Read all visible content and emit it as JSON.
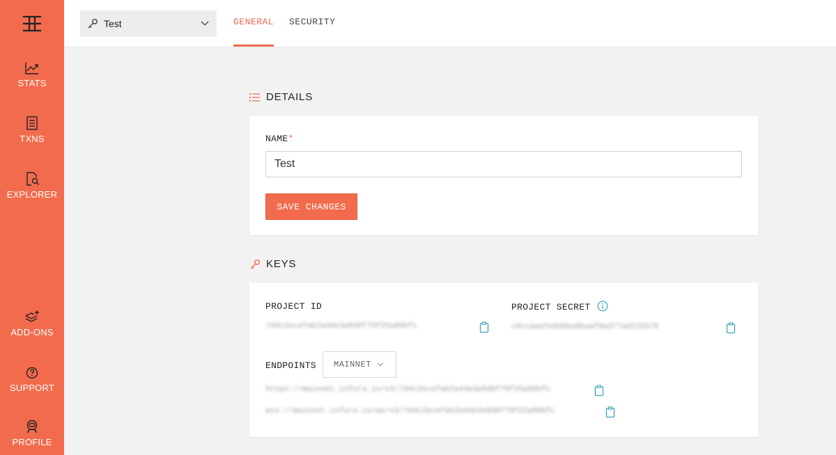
{
  "sidebar": {
    "items": [
      {
        "label": "STATS",
        "icon": "stats-chart-icon"
      },
      {
        "label": "TXNS",
        "icon": "receipt-icon"
      },
      {
        "label": "EXPLORER",
        "icon": "document-search-icon"
      },
      {
        "label": "ADD-ONS",
        "icon": "layers-add-icon"
      },
      {
        "label": "SUPPORT",
        "icon": "question-circle-icon"
      },
      {
        "label": "PROFILE",
        "icon": "astronaut-icon"
      }
    ]
  },
  "header": {
    "project_name": "Test",
    "tabs": [
      {
        "label": "GENERAL",
        "active": true
      },
      {
        "label": "SECURITY",
        "active": false
      }
    ]
  },
  "details": {
    "title": "DETAILS",
    "name_label": "NAME",
    "name_required": "*",
    "name_value": "Test",
    "save_label": "SAVE CHANGES"
  },
  "keys": {
    "title": "KEYS",
    "project_id_label": "PROJECT ID",
    "project_id_value": "7d4c2ecefab2a44e3a8d0f79f25a80bfc",
    "project_secret_label": "PROJECT SECRET",
    "project_secret_value": "c8ccaaefe8d8ke8kaaf6ed77ad215578",
    "endpoints_label": "ENDPOINTS",
    "network_selected": "MAINNET",
    "endpoint_https": "https://mainnet.infura.io/v3/7d4c2ecefab2a44e3a8d0f79f25a80bfc",
    "endpoint_wss": "wss://mainnet.infura.io/ws/v3/7d4c2ecefab2a44e3a8d0f79f25a80bfc"
  },
  "colors": {
    "accent": "#f26b4c",
    "copy_icon": "#3aa3b3",
    "info_icon": "#3aa3b3"
  }
}
